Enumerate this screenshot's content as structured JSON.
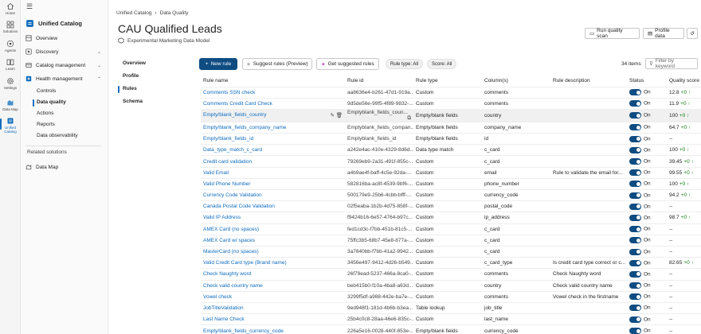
{
  "rail": [
    {
      "label": "Home",
      "icon": "home-icon"
    },
    {
      "label": "Solutions",
      "icon": "grid-icon"
    },
    {
      "label": "Agents",
      "icon": "agents-icon"
    },
    {
      "label": "Learn",
      "icon": "book-icon"
    },
    {
      "label": "Settings",
      "icon": "gear-icon"
    },
    {
      "label": "Data Map",
      "icon": "datamap-icon"
    },
    {
      "label": "Unified",
      "label2": "Catalog",
      "icon": "catalog-icon"
    }
  ],
  "nav": {
    "header": "Unified Catalog",
    "overview": "Overview",
    "discovery": "Discovery",
    "catalog_management": "Catalog management",
    "health_management": "Health management",
    "subitems": [
      "Controls",
      "Data quality",
      "Actions",
      "Reports",
      "Data observability"
    ],
    "related_heading": "Related solutions",
    "data_map": "Data Map"
  },
  "breadcrumb": [
    "Unified Catalog",
    "Data Quality"
  ],
  "page": {
    "title": "CAU Qualified Leads",
    "subtitle": "Experimental Marketing Data Model",
    "run_scan": "Run quality scan",
    "profile_data": "Profile data"
  },
  "tabs": [
    "Overview",
    "Profile",
    "Rules",
    "Schema"
  ],
  "toolbar": {
    "new_rule": "New rule",
    "suggest": "Suggest rules (Preview)",
    "get_suggested": "Get suggested rules",
    "rule_type": "Rule type: All",
    "score": "Score: All",
    "items": "34 items",
    "filter_placeholder": "Filter by keyword"
  },
  "table": {
    "headers": [
      "Rule name",
      "Rule id",
      "Rule type",
      "Column(s)",
      "Rule description",
      "Status",
      "Quality score"
    ],
    "status_label": "On",
    "rows": [
      {
        "name": "Comments SSN check",
        "id": "aa8636e4-b261-47d1-919a...",
        "type": "Custom",
        "column": "comments",
        "desc": "",
        "score": "12.8",
        "delta": "+0 ↑"
      },
      {
        "name": "Comments Credit Card Check",
        "id": "9d5de56e-99f5-4f89-9832-...",
        "type": "Custom",
        "column": "comments",
        "desc": "",
        "score": "11.9",
        "delta": "+0 ↑"
      },
      {
        "name": "Empty/blank_fields_country",
        "id": "Emptyblank_fields_coun...",
        "type": "Empty/blank fields",
        "column": "country",
        "desc": "",
        "score": "100",
        "delta": "+0 ↑"
      },
      {
        "name": "Empty/blank_fields_company_name",
        "id": "Emptyblank_fields_compan...",
        "type": "Empty/blank fields",
        "column": "company_name",
        "desc": "",
        "score": "64.7",
        "delta": "+0 ↑"
      },
      {
        "name": "Empty/blank_fields_id",
        "id": "Emptyblank_fields_id",
        "type": "Empty/blank fields",
        "column": "id",
        "desc": "",
        "score": "--",
        "delta": ""
      },
      {
        "name": "Data_type_match_c_card",
        "id": "a242e4ac-410e-4329-8d6d...",
        "type": "Data type match",
        "column": "c_card",
        "desc": "",
        "score": "100",
        "delta": "+0 ↑"
      },
      {
        "name": "Credit card validation",
        "id": "79269eb9-2a31-491f-855c-...",
        "type": "Custom",
        "column": "c_card",
        "desc": "",
        "score": "39.45",
        "delta": "+0 ↑"
      },
      {
        "name": "Valid Email",
        "id": "a4b9ae4f-baff-4c5e-92da-...",
        "type": "Custom",
        "column": "email",
        "desc": "Rule to validate the email for...",
        "score": "99.55",
        "delta": "+0 ↑"
      },
      {
        "name": "Valid Phone Number",
        "id": "582816ba-ac8f-4539-9bf6-...",
        "type": "Custom",
        "column": "phone_number",
        "desc": "",
        "score": "100",
        "delta": "+0 ↑"
      },
      {
        "name": "Currency Code Validation",
        "id": "500179e9-25b6-4cbb-bfff-...",
        "type": "Custom",
        "column": "currency_code",
        "desc": "",
        "score": "94.2",
        "delta": "+0 ↑"
      },
      {
        "name": "Canada Postal Code Validation",
        "id": "02f5eaba-1b2b-4d75-858f-...",
        "type": "Custom",
        "column": "postal_code",
        "desc": "",
        "score": "--",
        "delta": ""
      },
      {
        "name": "Valid IP Address",
        "id": "f9424b16-6e57-4764-b97c...",
        "type": "Custom",
        "column": "ip_address",
        "desc": "",
        "score": "98.7",
        "delta": "+0 ↑"
      },
      {
        "name": "AMEX Card (no spaces)",
        "id": "fed1cd3c-f7bb-451b-81c5-...",
        "type": "Custom",
        "column": "c_card",
        "desc": "",
        "score": "--",
        "delta": ""
      },
      {
        "name": "AMEX Card w/ spaces",
        "id": "75ffc3b5-68b7-45e8-877a-...",
        "type": "Custom",
        "column": "c_card",
        "desc": "",
        "score": "--",
        "delta": ""
      },
      {
        "name": "MasterCard (no spaces)",
        "id": "3a7840bb-f7bb-41a2-9942...",
        "type": "Custom",
        "column": "c_card",
        "desc": "",
        "score": "--",
        "delta": ""
      },
      {
        "name": "Valid Credit Card type (Brand name)",
        "id": "3456e497-9412-4d26-b549...",
        "type": "Custom",
        "column": "c_card_type",
        "desc": "Is credit card type correct or c...",
        "score": "82.65",
        "delta": "+0 ↑"
      },
      {
        "name": "Check Naughty word",
        "id": "26f79ead-5237-466a-8ca0-...",
        "type": "Custom",
        "column": "comments",
        "desc": "Check Naughty word",
        "score": "--",
        "delta": ""
      },
      {
        "name": "Check valid country name",
        "id": "beb415b0-f10a-4ba8-a63d...",
        "type": "Custom",
        "column": "country",
        "desc": "Check valid country name",
        "score": "--",
        "delta": ""
      },
      {
        "name": "Vowel check",
        "id": "3299f5df-a988-442e-ba7e-...",
        "type": "Custom",
        "column": "comments",
        "desc": "Vowel check in the firstname",
        "score": "--",
        "delta": ""
      },
      {
        "name": "JobTitleValidation",
        "id": "9ed948f1-181d-4b6b-b3ea...",
        "type": "Table lookup",
        "column": "job_title",
        "desc": "",
        "score": "--",
        "delta": ""
      },
      {
        "name": "Last Name Check",
        "id": "25b4c0c8-28aa-46e6-835c-...",
        "type": "Custom",
        "column": "last_name",
        "desc": "",
        "score": "--",
        "delta": ""
      },
      {
        "name": "Empty/blank_fields_currency_code",
        "id": "226a5e16-0028-440f-853e-...",
        "type": "Empty/blank fields",
        "column": "currency_code",
        "desc": "",
        "score": "--",
        "delta": ""
      }
    ]
  }
}
